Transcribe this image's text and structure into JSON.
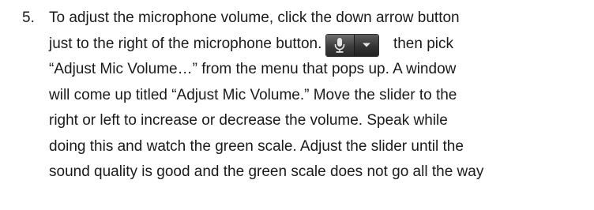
{
  "instruction": {
    "number": "5.",
    "lines": [
      "To adjust the microphone volume, click the down arrow button",
      "just to the right of the microphone button.",
      "“Adjust Mic Volume…” from the menu that pops up.  A window",
      "will come up titled “Adjust Mic Volume.”  Move the slider to the",
      "right or left to increase or decrease the volume.  Speak while",
      "doing this and watch the green scale.  Adjust the slider until the",
      "sound quality is good and the green scale does not go all the way"
    ],
    "line2_after_widget": "then pick"
  },
  "widget": {
    "mic_icon": "microphone-icon",
    "arrow_icon": "chevron-down-icon",
    "colors": {
      "button_dark": "#333333",
      "icon_light": "#e6e6e6"
    }
  }
}
